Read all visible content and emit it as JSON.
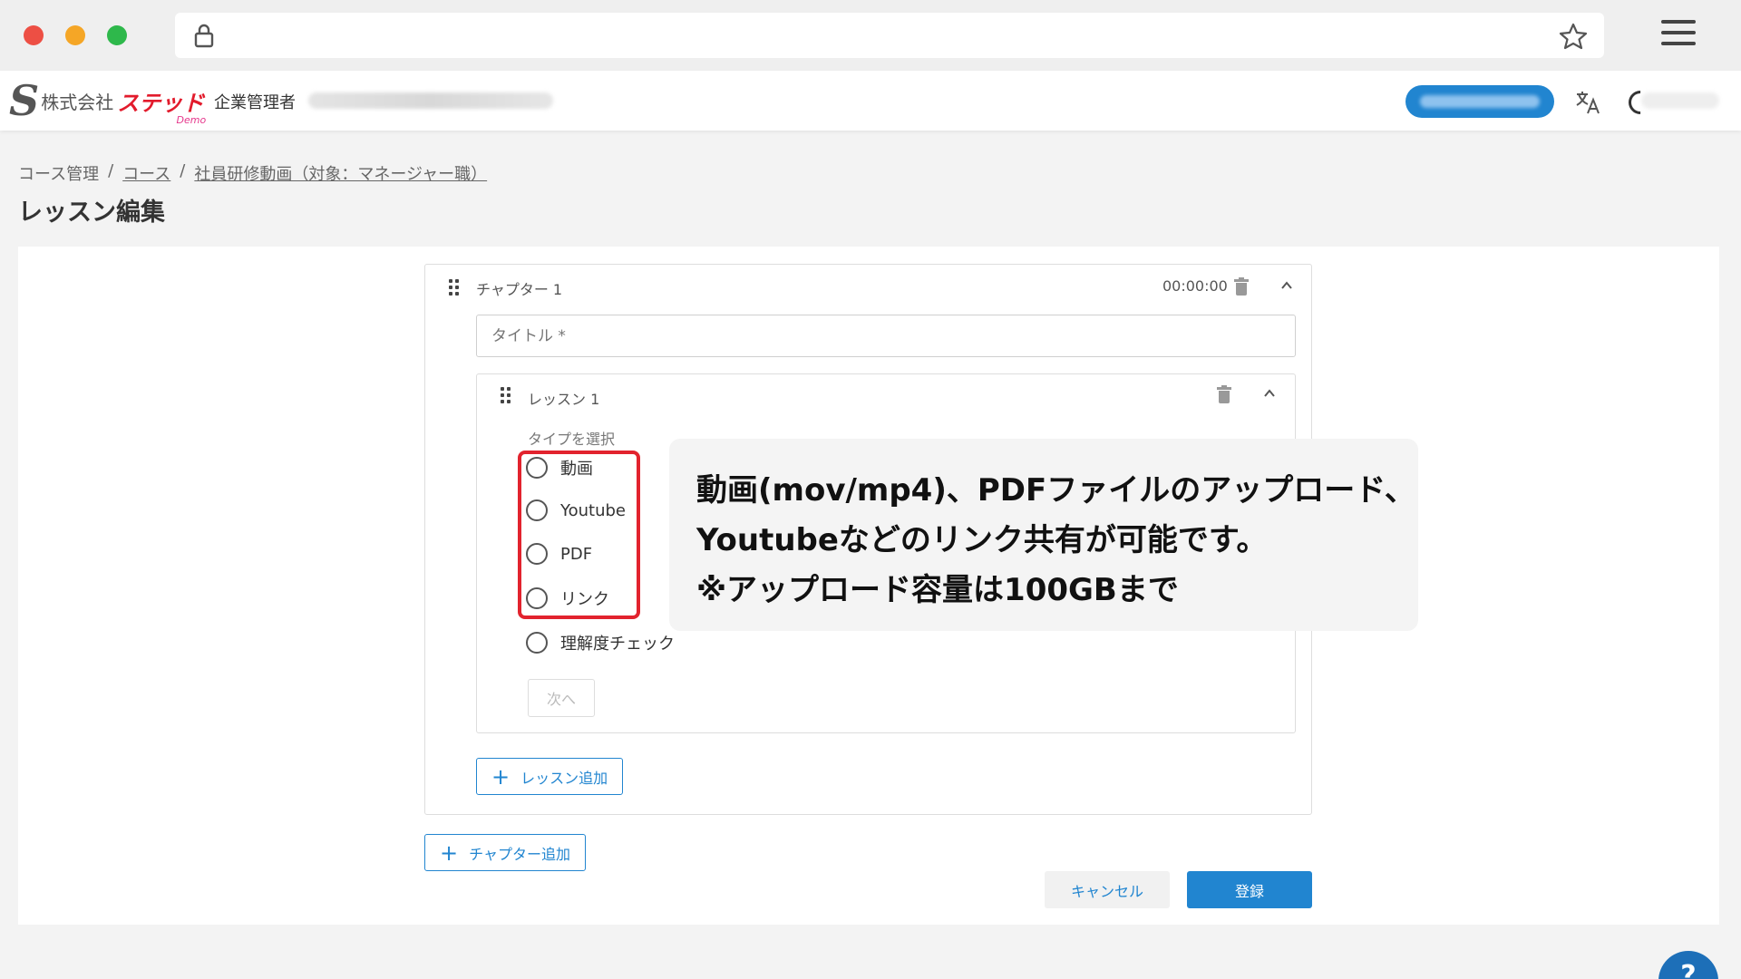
{
  "chrome": {
    "window_controls": [
      "close",
      "minimize",
      "maximize"
    ],
    "icons": {
      "lock": "lock-icon",
      "bookmark": "star-icon",
      "menu": "hamburger-menu-icon"
    }
  },
  "header": {
    "company_prefix": "株式会社",
    "brand": "ステッド",
    "brand_sub": "Demo",
    "role": "企業管理者",
    "icons": {
      "translate": "translate-icon"
    },
    "colors": {
      "brand_red": "#e21b2c",
      "primary": "#2185d0"
    }
  },
  "breadcrumb": {
    "items": [
      "コース管理",
      "コース",
      "社員研修動画（対象：マネージャー職）"
    ],
    "separator": "/"
  },
  "page": {
    "title": "レッスン編集"
  },
  "chapter": {
    "label": "チャプター 1",
    "duration": "00:00:00",
    "title_placeholder": "タイトル *",
    "lesson": {
      "label": "レッスン 1",
      "type_label": "タイプを選択",
      "options": [
        "動画",
        "Youtube",
        "PDF",
        "リンク",
        "理解度チェック"
      ],
      "next_label": "次へ"
    },
    "add_lesson_label": "レッスン追加"
  },
  "add_chapter_label": "チャプター追加",
  "actions": {
    "cancel": "キャンセル",
    "submit": "登録"
  },
  "callout": {
    "lines": [
      "動画(mov/mp4)、PDFファイルのアップロード、",
      "Youtubeなどのリンク共有が可能です。",
      "※アップロード容量は100GBまで"
    ]
  },
  "help": {
    "label": "?"
  }
}
